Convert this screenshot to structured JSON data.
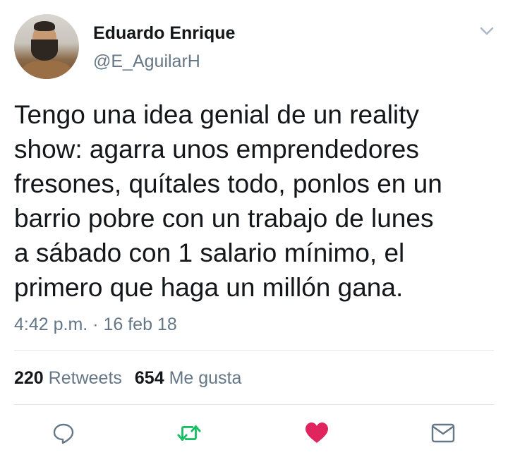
{
  "author": {
    "name": "Eduardo Enrique",
    "handle": "@E_AguilarH"
  },
  "tweet": {
    "lines": [
      "Tengo una idea genial de un reality",
      "show: agarra unos emprendedores",
      "fresones, quítales todo, ponlos en un",
      "barrio pobre con un trabajo de lunes",
      "a sábado con 1 salario mínimo, el",
      "primero que haga un millón gana."
    ],
    "time": "4:42 p.m.",
    "separator": "·",
    "date": "16 feb 18"
  },
  "stats": {
    "retweets_count": "220",
    "retweets_label": "Retweets",
    "likes_count": "654",
    "likes_label": "Me gusta"
  },
  "actions": {
    "reply_icon": "reply-icon",
    "retweet_icon": "retweet-icon",
    "like_icon": "heart-icon",
    "message_icon": "envelope-icon"
  },
  "colors": {
    "text": "#14171a",
    "secondary": "#657786",
    "divider": "#e1e8ed",
    "reply": "#657786",
    "retweet": "#17bf63",
    "like": "#e0245e",
    "message": "#657786"
  }
}
